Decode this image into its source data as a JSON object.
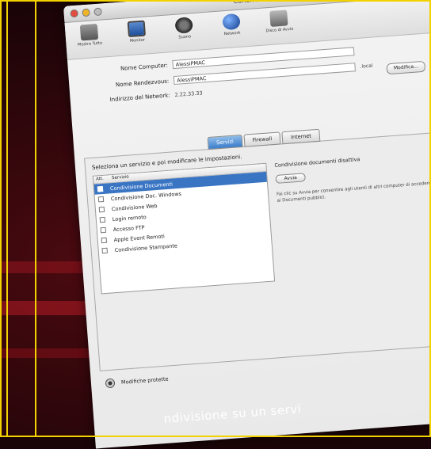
{
  "window": {
    "title": "Condivisione"
  },
  "toolbar": {
    "items": [
      {
        "label": "Mostra Tutto",
        "icon": "show-all-icon"
      },
      {
        "label": "Monitor",
        "icon": "monitor-icon"
      },
      {
        "label": "Suono",
        "icon": "sound-icon"
      },
      {
        "label": "Network",
        "icon": "network-icon"
      },
      {
        "label": "Disco di Avvio",
        "icon": "startup-disk-icon"
      }
    ]
  },
  "fields": {
    "computer_name_label": "Nome Computer:",
    "computer_name_value": "AlessiPMAC",
    "rendezvous_label": "Nome Rendezvous:",
    "rendezvous_value": "AlessiPMAC",
    "local_suffix": ".local",
    "modify_button": "Modifica...",
    "network_address_label": "Indirizzo del Network:",
    "network_address_value": "2.22.33.33"
  },
  "tabs": [
    "Servizi",
    "Firewall",
    "Internet"
  ],
  "panel": {
    "instruction": "Seleziona un servizio e poi modificare le impostazioni.",
    "list_header": [
      "Att.",
      "Servizio"
    ],
    "services": [
      {
        "label": "Condivisione Documenti",
        "selected": true
      },
      {
        "label": "Condivisione Doc. Windows",
        "selected": false
      },
      {
        "label": "Condivisione Web",
        "selected": false
      },
      {
        "label": "Login remoto",
        "selected": false
      },
      {
        "label": "Accesso FTP",
        "selected": false
      },
      {
        "label": "Apple Event Remoti",
        "selected": false
      },
      {
        "label": "Condivisione Stampante",
        "selected": false
      }
    ],
    "status_title": "Condivisione documenti disattiva",
    "start_button": "Avvia",
    "help_text": "Fai clic su Avvia per consentire agli utenti di altri computer di accedere ai Documenti pubblici."
  },
  "bottom": {
    "lock_label": "Modifiche protette"
  },
  "caption": "ndivisione su un servi"
}
